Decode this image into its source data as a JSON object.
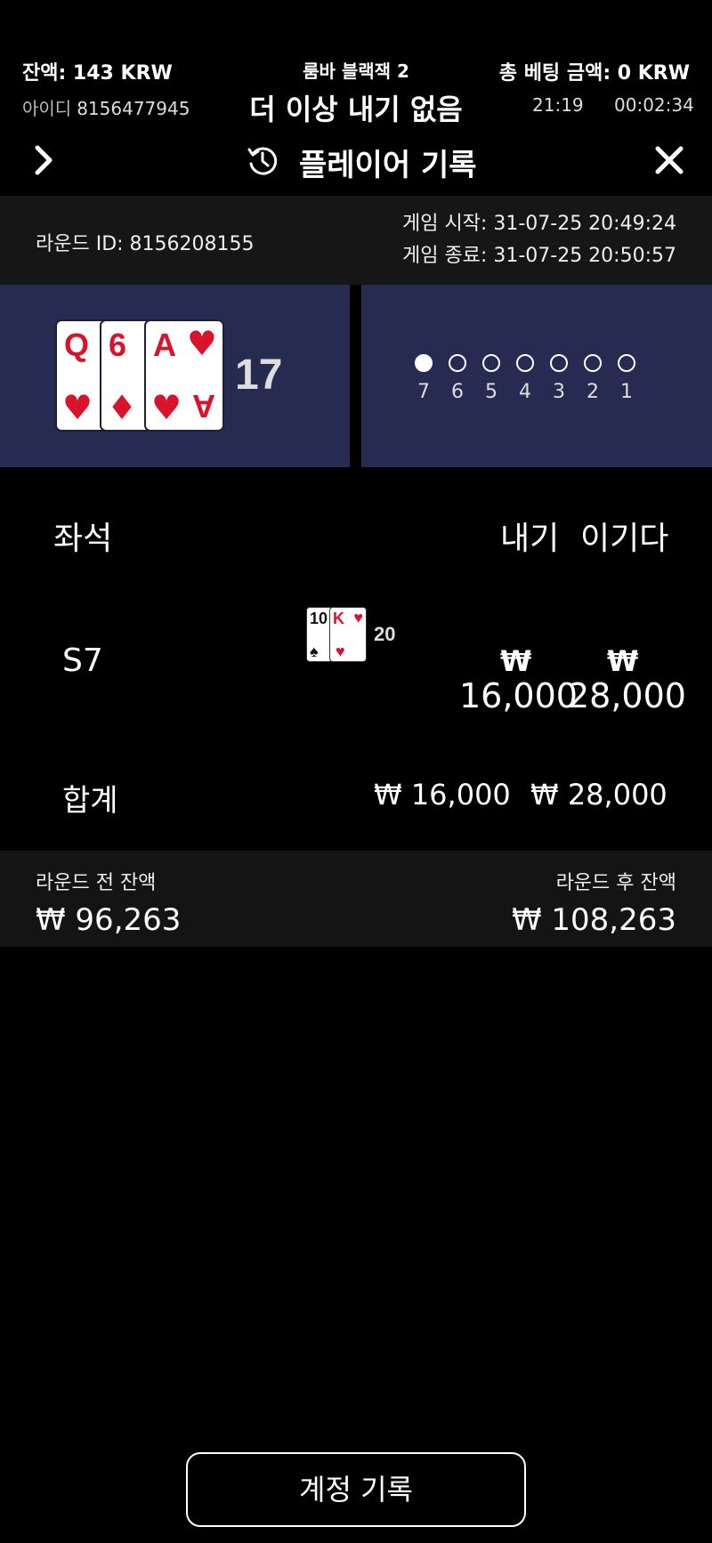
{
  "status": {
    "balance": "잔액: 143 KRW",
    "table_name": "룸바 블랙잭 2",
    "total_bet": "총 베팅 금액: 0 KRW",
    "user_id_label": "아이디",
    "user_id": "8156477945",
    "bet_status": "더 이상 내기 없음",
    "clock": "21:19",
    "elapsed": "00:02:34"
  },
  "header": {
    "title": "플레이어 기록",
    "icons": [
      "chevron-right-icon",
      "history-icon",
      "close-icon"
    ]
  },
  "round": {
    "id_text": "라운드 ID: 8156208155",
    "start_text": "게임 시작: 31-07-25 20:49:24",
    "end_text": "게임 종료: 31-07-25 20:50:57"
  },
  "dealer": {
    "cards": [
      {
        "rank": "Q",
        "suit": "♥"
      },
      {
        "rank": "6",
        "suit": "♦"
      },
      {
        "rank": "A",
        "suit": "♥"
      }
    ],
    "total": "17"
  },
  "pager": {
    "pages": [
      "7",
      "6",
      "5",
      "4",
      "3",
      "2",
      "1"
    ],
    "active_index": 0
  },
  "table": {
    "col_seat": "좌석",
    "col_bet": "내기",
    "col_win": "이기다",
    "rows": [
      {
        "seat": "S7",
        "cards": [
          {
            "rank": "10",
            "suit": "♠",
            "color": "#111111"
          },
          {
            "rank": "K",
            "suit": "♥",
            "color": "#d9132c"
          }
        ],
        "hand_total": "20",
        "bet_symbol": "₩",
        "bet_amount": "16,000",
        "win_symbol": "₩",
        "win_amount": "28,000"
      }
    ],
    "total_label": "합계",
    "total_bet": "₩ 16,000",
    "total_win": "₩ 28,000"
  },
  "balances": {
    "before_label": "라운드 전 잔액",
    "before_value": "₩ 96,263",
    "after_label": "라운드 후 잔액",
    "after_value": "₩ 108,263"
  },
  "footer": {
    "account_history": "계정 기록"
  },
  "colors": {
    "panel": "#272b52",
    "card_red": "#d9132c",
    "bar": "#161616"
  }
}
